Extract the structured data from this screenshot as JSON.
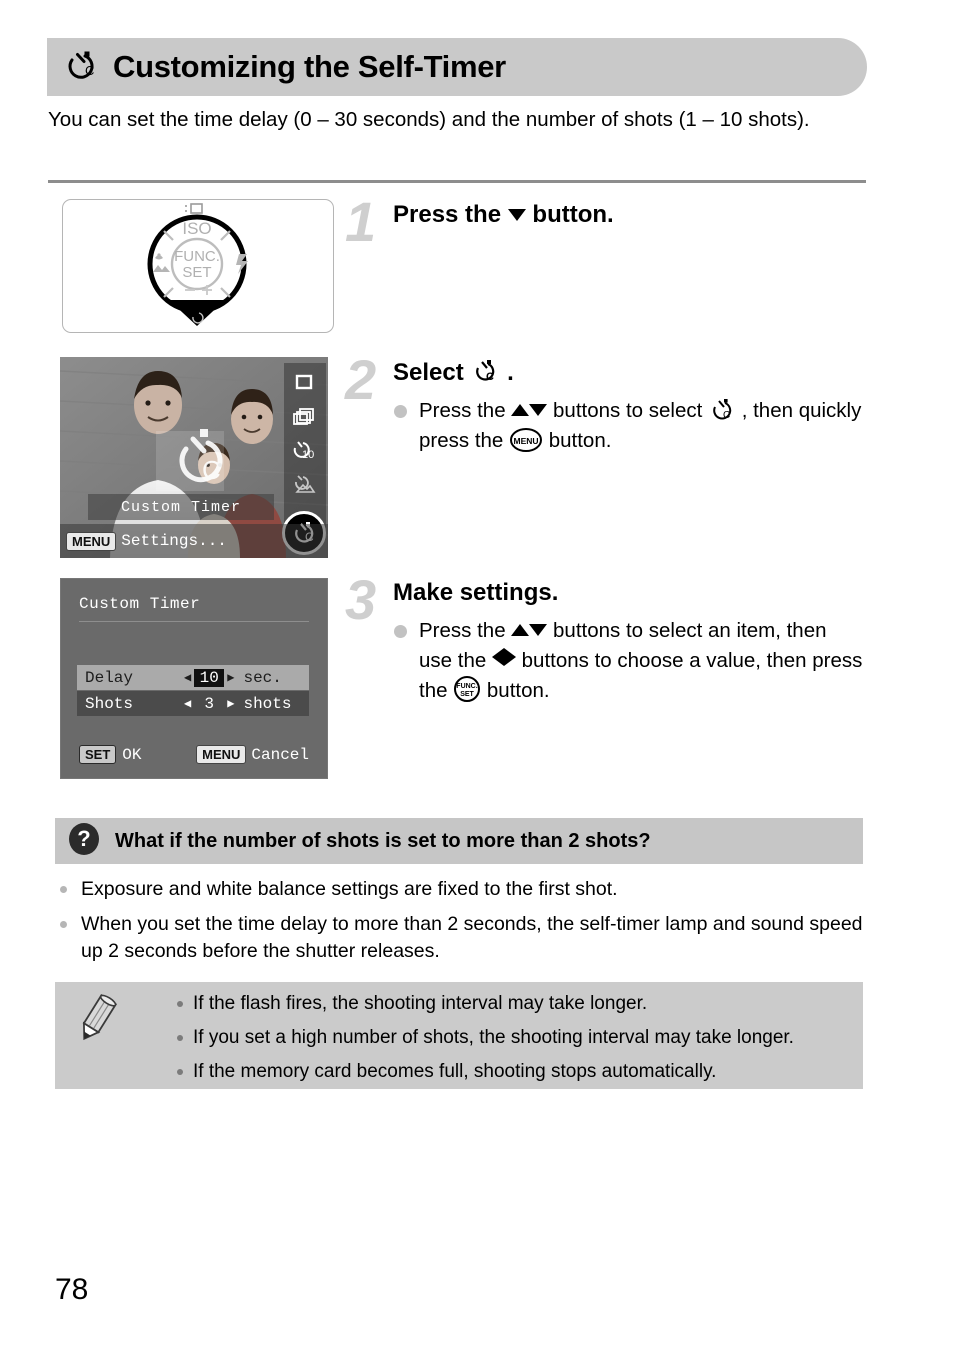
{
  "page": {
    "number": "78",
    "title": "Customizing the Self-Timer",
    "title_icon": "custom-self-timer-icon",
    "intro": "You can set the time delay (0 – 30 seconds) and the number of shots (1 – 10 shots)."
  },
  "steps": [
    {
      "number": "1",
      "title_before": "Press the",
      "title_icon": "triangle-down-icon",
      "title_after": "button.",
      "body": null
    },
    {
      "number": "2",
      "title_before": "Select",
      "title_icon": "custom-self-timer-icon",
      "title_after": ".",
      "body_part1": "Press the",
      "body_icon1": "triangle-up-down-icons",
      "body_part2": "buttons to select",
      "body_icon2": "custom-self-timer-icon",
      "body_part3": ", then quickly press the",
      "body_icon3": "menu-button-icon",
      "body_part4": "button."
    },
    {
      "number": "3",
      "title_before": "Make settings.",
      "body_part1": "Press the",
      "body_icon1": "triangle-up-down-icons",
      "body_part2": "buttons to select an item, then use the",
      "body_icon2": "triangle-left-right-icons",
      "body_part3": "buttons to choose a value, then press the",
      "body_icon3": "func-set-button-icon",
      "body_part4": "button."
    }
  ],
  "figures": {
    "dial": {
      "top_label": "ISO",
      "center_label_line1": "FUNC.",
      "center_label_line2": "SET",
      "left_icon": "macro-icon",
      "right_icon": "flash-icon",
      "highlighted": "down-button"
    },
    "lcd_shot": {
      "caption": "Custom Timer",
      "bottom_tag": "MENU",
      "bottom_text": "Settings...",
      "drive_modes": [
        "single-shot-icon",
        "continuous-shot-icon",
        "self-timer-10sec-icon",
        "face-self-timer-icon",
        "custom-self-timer-icon"
      ],
      "selected_drive_mode": "custom-self-timer-icon",
      "overlay_icon": "custom-self-timer-icon"
    },
    "lcd_menu": {
      "title": "Custom Timer",
      "rows": [
        {
          "label": "Delay",
          "value": "10",
          "unit": "sec.",
          "selected": true,
          "value_highlighted": true
        },
        {
          "label": "Shots",
          "value": "3",
          "unit": "shots",
          "selected": false,
          "value_highlighted": false
        }
      ],
      "footer": {
        "set_tag": "SET",
        "set_label": "OK",
        "menu_tag": "MENU",
        "menu_label": "Cancel"
      }
    }
  },
  "faq": {
    "icon": "question-mark-icon",
    "title": "What if the number of shots is set to more than 2 shots?",
    "items": [
      "Exposure and white balance settings are fixed to the first shot.",
      "When you set the time delay to more than 2 seconds, the self-timer lamp and sound speed up 2 seconds before the shutter releases."
    ]
  },
  "notes": {
    "icon": "pencil-icon",
    "items": [
      "If the flash fires, the shooting interval may take longer.",
      "If you set a high number of shots, the shooting interval may take longer.",
      "If the memory card becomes full, shooting stops automatically."
    ]
  },
  "colors": {
    "header_band": "#c9c9c9",
    "faq_band": "#c6c6c6",
    "note_box": "#cbcbcb",
    "step_number": "#cfcfcf",
    "rule": "#8d8d8d"
  }
}
